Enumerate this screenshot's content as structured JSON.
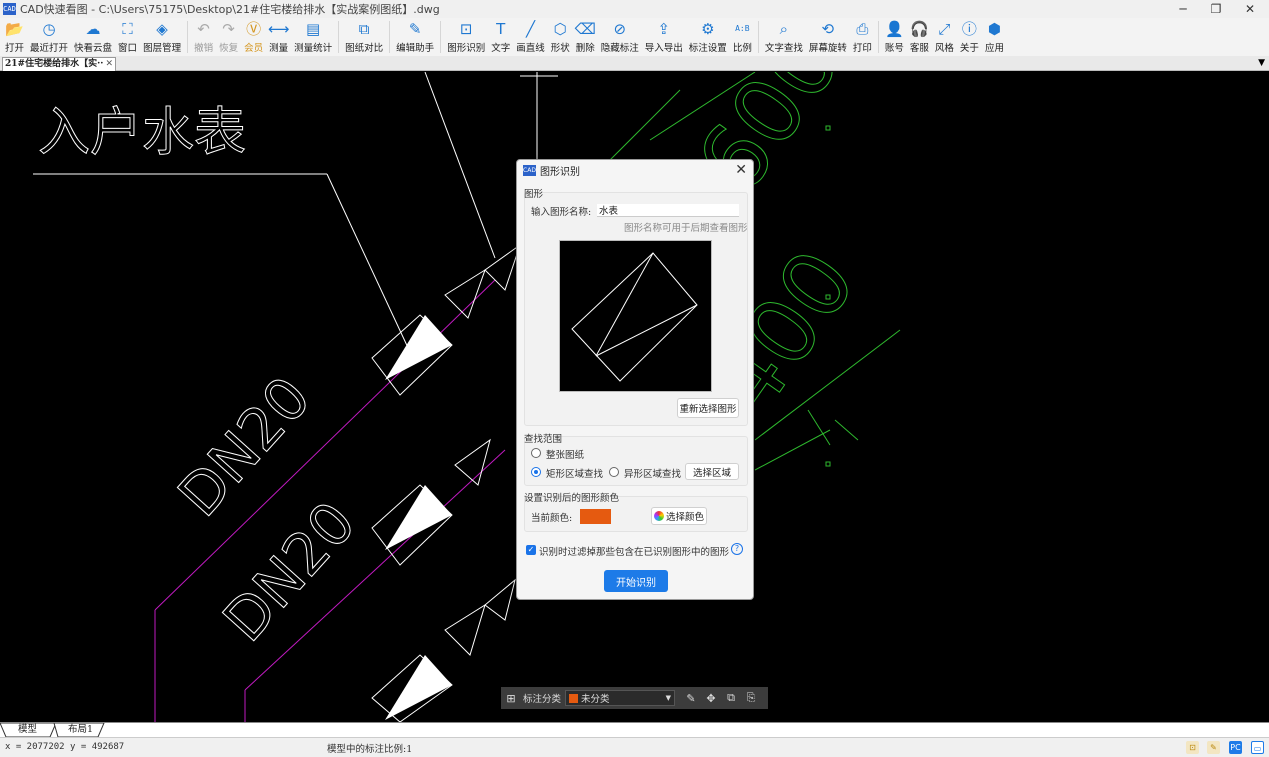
{
  "window": {
    "title": "CAD快速看图 - C:\\Users\\75175\\Desktop\\21#住宅楼给排水【实战案例图纸】.dwg",
    "logo_text": "CAD",
    "minimize": "─",
    "maximize": "❐",
    "close": "✕"
  },
  "toolbar": [
    {
      "name": "open",
      "label": "打开",
      "icon": "folder-icon",
      "glyph": "📂"
    },
    {
      "name": "recent",
      "label": "最近打开",
      "icon": "clock-icon",
      "glyph": "◷"
    },
    {
      "name": "cloud",
      "label": "快看云盘",
      "icon": "cloud-icon",
      "glyph": "☁"
    },
    {
      "name": "window",
      "label": "窗口",
      "icon": "window-icon",
      "glyph": "⛶"
    },
    {
      "name": "layers",
      "label": "图层管理",
      "icon": "layers-icon",
      "glyph": "◈"
    },
    {
      "name": "undo",
      "label": "撤销",
      "icon": "undo-icon",
      "glyph": "↶",
      "disabled": true
    },
    {
      "name": "redo",
      "label": "恢复",
      "icon": "redo-icon",
      "glyph": "↷",
      "disabled": true
    },
    {
      "name": "vip",
      "label": "会员",
      "icon": "vip-icon",
      "glyph": "Ⓥ",
      "vip": true
    },
    {
      "name": "measure",
      "label": "测量",
      "icon": "ruler-icon",
      "glyph": "⟷"
    },
    {
      "name": "measure-stats",
      "label": "测量统计",
      "icon": "stats-icon",
      "glyph": "▤"
    },
    {
      "name": "compare",
      "label": "图纸对比",
      "icon": "compare-icon",
      "glyph": "⧉"
    },
    {
      "name": "edit-helper",
      "label": "编辑助手",
      "icon": "edit-helper-icon",
      "glyph": "✎"
    },
    {
      "name": "shape-recognize",
      "label": "图形识别",
      "icon": "shape-recognize-icon",
      "glyph": "⊡"
    },
    {
      "name": "text",
      "label": "文字",
      "icon": "text-icon",
      "glyph": "T"
    },
    {
      "name": "line",
      "label": "画直线",
      "icon": "line-icon",
      "glyph": "╱"
    },
    {
      "name": "shape",
      "label": "形状",
      "icon": "shape-icon",
      "glyph": "⬡"
    },
    {
      "name": "delete",
      "label": "删除",
      "icon": "eraser-icon",
      "glyph": "⌫"
    },
    {
      "name": "hide-annotations",
      "label": "隐藏标注",
      "icon": "eye-off-icon",
      "glyph": "⊘"
    },
    {
      "name": "import-export",
      "label": "导入导出",
      "icon": "export-icon",
      "glyph": "⇪"
    },
    {
      "name": "annotation-settings",
      "label": "标注设置",
      "icon": "settings-icon",
      "glyph": "⚙"
    },
    {
      "name": "scale",
      "label": "比例",
      "icon": "scale-icon",
      "glyph": "A:B"
    },
    {
      "name": "find-text",
      "label": "文字查找",
      "icon": "search-icon",
      "glyph": "⌕"
    },
    {
      "name": "rotate",
      "label": "屏幕旋转",
      "icon": "rotate-icon",
      "glyph": "⟲"
    },
    {
      "name": "print",
      "label": "打印",
      "icon": "print-icon",
      "glyph": "⎙"
    },
    {
      "name": "account",
      "label": "账号",
      "icon": "user-icon",
      "glyph": "👤"
    },
    {
      "name": "support",
      "label": "客服",
      "icon": "headset-icon",
      "glyph": "🎧"
    },
    {
      "name": "style",
      "label": "风格",
      "icon": "style-icon",
      "glyph": "⤢"
    },
    {
      "name": "about",
      "label": "关于",
      "icon": "info-icon",
      "glyph": "ⓘ"
    },
    {
      "name": "apps",
      "label": "应用",
      "icon": "apps-icon",
      "glyph": "⬢"
    }
  ],
  "doc_tab": {
    "label": "21#住宅楼给排水【实··",
    "close": "✕"
  },
  "drawing": {
    "label_meter": "入户水表",
    "label_dn1": "DN20",
    "label_dn2": "DN20",
    "label_600": "600",
    "label_400": "400"
  },
  "dialog": {
    "title": "图形识别",
    "logo_text": "CAD",
    "close": "✕",
    "shape_group_title": "图形",
    "name_label": "输入图形名称:",
    "name_value": "水表",
    "name_hint": "图形名称可用于后期查看图形",
    "reselect_button": "重新选择图形",
    "scope_group_title": "查找范围",
    "scope_options": [
      {
        "label": "整张图纸",
        "checked": false
      },
      {
        "label": "矩形区域查找",
        "checked": true
      },
      {
        "label": "异形区域查找",
        "checked": false
      }
    ],
    "select_area_button": "选择区域",
    "color_group_title": "设置识别后的图形颜色",
    "current_color_label": "当前颜色:",
    "current_color": "#e55a10",
    "choose_color_button": "选择颜色",
    "filter_checkbox_label": "识别时过滤掉那些包含在已识别图形中的图形",
    "filter_checked": true,
    "help": "?",
    "start_button": "开始识别"
  },
  "floatbar": {
    "label": "标注分类",
    "category": "未分类",
    "category_color": "#e55a10"
  },
  "layout_tabs": [
    "模型",
    "布局1"
  ],
  "status": {
    "coords": "x = 2077202  y = 492687",
    "scale_text": "模型中的标注比例:1"
  }
}
